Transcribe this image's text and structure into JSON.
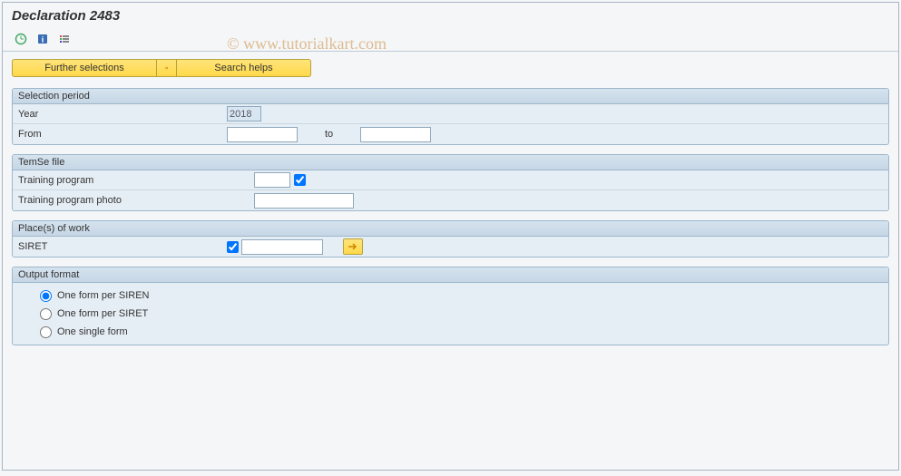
{
  "title": "Declaration 2483",
  "watermark": "© www.tutorialkart.com",
  "toolbar_buttons": {
    "further_selections": "Further selections",
    "search_helps": "Search helps"
  },
  "groups": {
    "selection_period": {
      "title": "Selection period",
      "year_label": "Year",
      "year_value": "2018",
      "from_label": "From",
      "from_value": "",
      "to_label": "to",
      "to_value": ""
    },
    "temse_file": {
      "title": "TemSe file",
      "training_program_label": "Training program",
      "training_program_checked": true,
      "training_program_photo_label": "Training program photo",
      "training_program_photo_value": ""
    },
    "places_of_work": {
      "title": "Place(s) of work",
      "siret_label": "SIRET",
      "siret_checked": true,
      "siret_value": ""
    },
    "output_format": {
      "title": "Output format",
      "options": [
        {
          "label": "One form per SIREN",
          "checked": true
        },
        {
          "label": "One form per SIRET",
          "checked": false
        },
        {
          "label": "One single form",
          "checked": false
        }
      ]
    }
  }
}
